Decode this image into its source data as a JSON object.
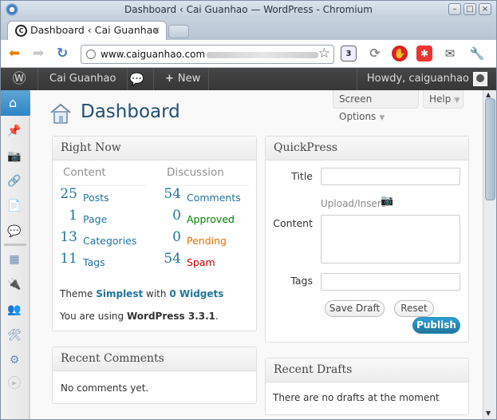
{
  "window": {
    "title": "Dashboard ‹ Cai Guanhao — WordPress - Chromium"
  },
  "tab": {
    "title": "Dashboard ‹ Cai Guanhao",
    "close": "×"
  },
  "address_bar": {
    "url": "www.caiguanhao.com"
  },
  "admin_bar": {
    "site_name": "Cai Guanhao",
    "new_label": "New",
    "howdy": "Howdy, caiguanhao"
  },
  "page": {
    "title": "Dashboard"
  },
  "screen_options": {
    "label": "Screen Options"
  },
  "help": {
    "label": "Help"
  },
  "right_now": {
    "title": "Right Now",
    "content_header": "Content",
    "discussion_header": "Discussion",
    "content": [
      {
        "count": "25",
        "label": "Posts"
      },
      {
        "count": "1",
        "label": "Page"
      },
      {
        "count": "13",
        "label": "Categories"
      },
      {
        "count": "11",
        "label": "Tags"
      }
    ],
    "discussion": [
      {
        "count": "54",
        "label": "Comments",
        "color": "#21759b"
      },
      {
        "count": "0",
        "label": "Approved",
        "color": "#008000"
      },
      {
        "count": "0",
        "label": "Pending",
        "color": "#e66f00"
      },
      {
        "count": "54",
        "label": "Spam",
        "color": "#cc0000"
      }
    ],
    "theme_prefix": "Theme",
    "theme_name": "Simplest",
    "theme_with": "with",
    "widgets": "0 Widgets",
    "version_prefix": "You are using",
    "version": "WordPress 3.3.1",
    "version_suffix": "."
  },
  "quickpress": {
    "title": "QuickPress",
    "title_label": "Title",
    "upload_label": "Upload/Insert",
    "content_label": "Content",
    "tags_label": "Tags",
    "save_draft": "Save Draft",
    "reset": "Reset",
    "publish": "Publish"
  },
  "recent_comments": {
    "title": "Recent Comments",
    "empty": "No comments yet."
  },
  "recent_drafts": {
    "title": "Recent Drafts",
    "empty": "There are no drafts at the moment"
  }
}
